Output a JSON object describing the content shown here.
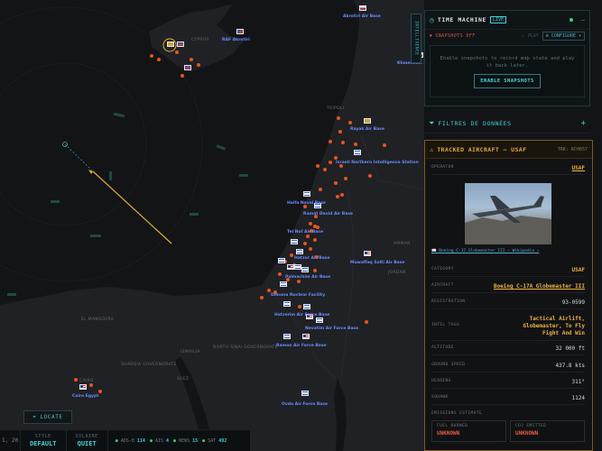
{
  "map": {
    "locate_label": "LOCATE",
    "places": [
      {
        "name": "CYPRUS"
      },
      {
        "name": "TRIPOLI"
      },
      {
        "name": "EL MANSOURA"
      },
      {
        "name": "CAIRO"
      },
      {
        "name": "ISMAILIA"
      },
      {
        "name": "SUEZ"
      },
      {
        "name": "SHARQIA GOVERNORATE"
      },
      {
        "name": "NORTH SINAI GOVERNORATE"
      },
      {
        "name": "JORDAN"
      },
      {
        "name": "AMMAN"
      }
    ],
    "bases": [
      {
        "name": "Akrotiri Air Base"
      },
      {
        "name": "RAF Akrotiri"
      },
      {
        "name": "Khmeimim Air Base"
      },
      {
        "name": "Rayak Air Base"
      },
      {
        "name": "Ramat David Air Base"
      },
      {
        "name": "Haifa Naval Base"
      },
      {
        "name": "Israeli Northern Intelligence Station"
      },
      {
        "name": "Tel Nof Air Base"
      },
      {
        "name": "Hatzor Air Base"
      },
      {
        "name": "Palmachim Air Base"
      },
      {
        "name": "Nevatim Air Force Base"
      },
      {
        "name": "Hatzerim Air Force Base"
      },
      {
        "name": "Ramon Air Force Base"
      },
      {
        "name": "Ovda Air Force Base"
      },
      {
        "name": "Dimona Nuclear Facility"
      },
      {
        "name": "Cairo Egypt"
      },
      {
        "name": "Muwaffaq Salti Air Base"
      }
    ]
  },
  "status_bar": {
    "coord": "1, 20",
    "style_key": "STYLE",
    "style_val": "DEFAULT",
    "solar_key": "SOLAIRE",
    "solar_val": "QUIET",
    "counts": [
      {
        "label": "ADS-B",
        "value": "114"
      },
      {
        "label": "AIS",
        "value": "4"
      },
      {
        "label": "NEWS",
        "value": "15"
      },
      {
        "label": "SAT",
        "value": "492"
      }
    ]
  },
  "side_tab": "INTELLIGENCE",
  "time_machine": {
    "title": "TIME MACHINE",
    "badge": "LIVE",
    "close": "–",
    "snapshots_off": "⏺ SNAPSHOTS OFF",
    "play": "▷ PLAY",
    "configure": "⚙ CONFIGURE ▾",
    "message": "Enable snapshots to record map state and play it back later.",
    "enable": "ENABLE SNAPSHOTS"
  },
  "filters": {
    "title": "FILTRES DE DONNÉES",
    "plus": "+"
  },
  "aircraft": {
    "title": "TRACKED AIRCRAFT — USAF",
    "trk": "TRK: RCH657",
    "operator_k": "OPERATOR",
    "operator_v": "USAF",
    "caption": "📖 Boeing C-17 Globemaster III — Wikipedia ↗",
    "category_k": "CATEGORY",
    "category_v": "USAF",
    "aircraft_k": "AIRCRAFT",
    "aircraft_v": "Boeing C-17A Globemaster III",
    "reg_k": "REGISTRATION",
    "reg_v": "93-0599",
    "intel_k": "INTEL TAGS",
    "intel_v": "Tactical Airlift, Globemaster, To Fly Fight And Win",
    "alt_k": "ALTITUDE",
    "alt_v": "32 000 ft",
    "gs_k": "GROUND SPEED",
    "gs_v": "437.8 kts",
    "hdg_k": "HEADING",
    "hdg_v": "311°",
    "sq_k": "SQUAWK",
    "sq_v": "1124",
    "emis_title": "EMISSIONS ESTIMATE",
    "fuel_k": "FUEL BURNED",
    "fuel_v": "UNKNOWN",
    "co2_k": "CO2 EMITTED",
    "co2_v": "UNKNOWN"
  },
  "colors": {
    "accent": "#3fd4d8",
    "amber": "#f0b33c",
    "alert": "#ea5a3e",
    "marker": "#e8541f",
    "base_label": "#6a8cff",
    "land": "#1f2124",
    "sea": "#121416"
  }
}
